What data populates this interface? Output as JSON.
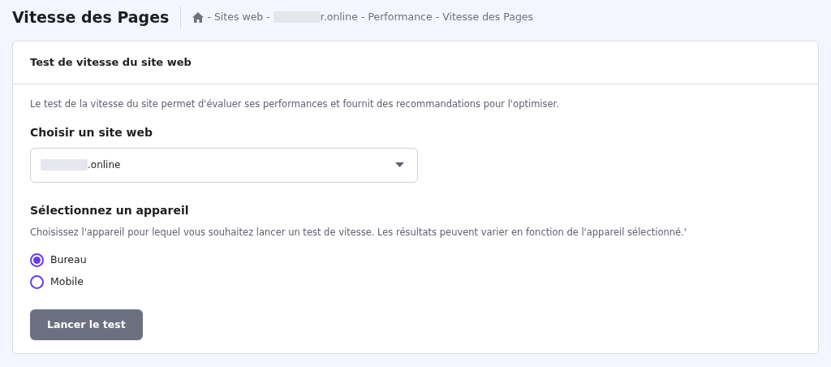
{
  "page_title": "Vitesse des Pages",
  "breadcrumb_separator": "-",
  "breadcrumb": [
    {
      "kind": "home"
    },
    {
      "kind": "text",
      "label": "Sites web"
    },
    {
      "kind": "redacted",
      "label": "r.online"
    },
    {
      "kind": "text",
      "label": "Performance"
    },
    {
      "kind": "text",
      "label": "Vitesse des Pages"
    }
  ],
  "card": {
    "title": "Test de vitesse du site web",
    "intro": "Le test de la vitesse du site permet d'évaluer ses performances et fournit des recommandations pour l'optimiser.",
    "site_label": "Choisir un site web",
    "site_select": {
      "value": ".online"
    },
    "device_label": "Sélectionnez un appareil",
    "device_help": "Choisissez l'appareil pour lequel vous souhaitez lancer un test de vitesse. Les résultats peuvent varier en fonction de l'appareil sélectionné.'",
    "devices": [
      {
        "label": "Bureau",
        "selected": true
      },
      {
        "label": "Mobile",
        "selected": false
      }
    ],
    "button": {
      "label": "Lancer le test",
      "disabled": true
    }
  }
}
